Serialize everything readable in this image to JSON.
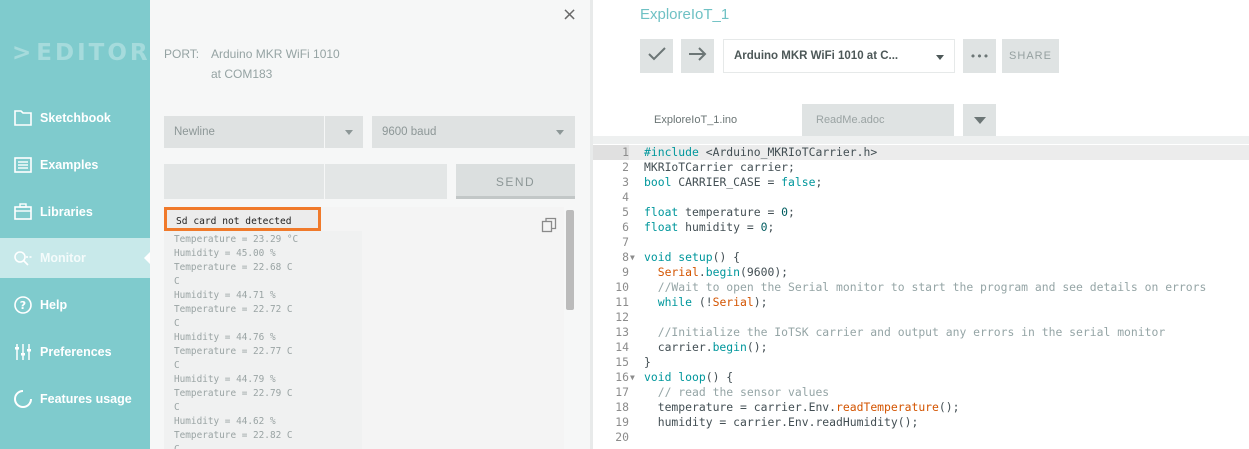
{
  "sidebar": {
    "logo": "EDITOR",
    "items": [
      {
        "label": "Sketchbook",
        "icon": "folder-icon"
      },
      {
        "label": "Examples",
        "icon": "examples-icon"
      },
      {
        "label": "Libraries",
        "icon": "libraries-icon"
      },
      {
        "label": "Monitor",
        "icon": "monitor-icon"
      },
      {
        "label": "Help",
        "icon": "help-icon"
      },
      {
        "label": "Preferences",
        "icon": "preferences-icon"
      },
      {
        "label": "Features usage",
        "icon": "features-usage-icon"
      }
    ],
    "active": "Monitor"
  },
  "monitor": {
    "close": "×",
    "port_label": "PORT:",
    "port_line1": "Arduino MKR WiFi 1010",
    "port_line2": "at COM183",
    "line_ending": "Newline",
    "baud": "9600 baud",
    "send_label": "SEND",
    "highlight_line": "Sd card not detected",
    "output_lines": [
      "Temperature = 23.29 °C",
      "Humidity = 45.00 %",
      "Temperature = 22.68 C",
      "C",
      "Humidity = 44.71 %",
      "Temperature = 22.72 C",
      "C",
      "Humidity = 44.76 %",
      "Temperature = 22.77 C",
      "C",
      "Humidity = 44.79 %",
      "Temperature = 22.79 C",
      "C",
      "Humidity = 44.62 %",
      "Temperature = 22.82 C",
      "C"
    ]
  },
  "editor": {
    "sketch_title": "ExploreIoT_1",
    "board": "Arduino MKR WiFi 1010 at C...",
    "more": "•••",
    "share": "SHARE",
    "tabs": [
      {
        "label": "ExploreIoT_1.ino",
        "active": true
      },
      {
        "label": "ReadMe.adoc",
        "active": false
      }
    ],
    "code_lines": [
      {
        "n": "1",
        "html": "<span class=\"k\">#include</span> &lt;Arduino_MKRIoTCarrier.h&gt;"
      },
      {
        "n": "2",
        "html": "MKRIoTCarrier carrier;"
      },
      {
        "n": "3",
        "html": "<span class=\"k\">bool</span> CARRIER_CASE = <span class=\"k\">false</span>;"
      },
      {
        "n": "4",
        "html": ""
      },
      {
        "n": "5",
        "html": "<span class=\"k\">float</span> temperature = <span class=\"n\">0</span>;"
      },
      {
        "n": "6",
        "html": "<span class=\"k\">float</span> humidity = <span class=\"n\">0</span>;"
      },
      {
        "n": "7",
        "html": ""
      },
      {
        "n": "8",
        "html": "<span class=\"k\">void</span> <span class=\"k\">setup</span>() {",
        "fold": true
      },
      {
        "n": "9",
        "html": "  <span class=\"f\">Serial</span>.<span class=\"k\">begin</span>(9600);"
      },
      {
        "n": "10",
        "html": "  <span class=\"c\">//Wait to open the Serial monitor to start the program and see details on errors</span>"
      },
      {
        "n": "11",
        "html": "  <span class=\"k\">while</span> (!<span class=\"f\">Serial</span>);"
      },
      {
        "n": "12",
        "html": ""
      },
      {
        "n": "13",
        "html": "  <span class=\"c\">//Initialize the IoTSK carrier and output any errors in the serial monitor</span>"
      },
      {
        "n": "14",
        "html": "  carrier.<span class=\"k\">begin</span>();"
      },
      {
        "n": "15",
        "html": "}"
      },
      {
        "n": "16",
        "html": "<span class=\"k\">void</span> <span class=\"k\">loop</span>() {",
        "fold": true
      },
      {
        "n": "17",
        "html": "  <span class=\"c\">// read the sensor values</span>"
      },
      {
        "n": "18",
        "html": "  temperature = carrier.Env.<span class=\"f\">readTemperature</span>();"
      },
      {
        "n": "19",
        "html": "  humidity = carrier.Env.readHumidity();"
      },
      {
        "n": "20",
        "html": ""
      }
    ]
  }
}
